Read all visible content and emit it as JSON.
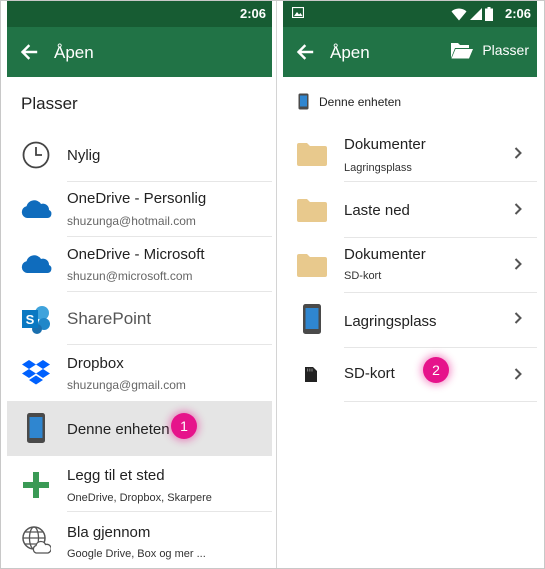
{
  "left": {
    "status": {
      "time": "2:06"
    },
    "appbar": {
      "title": "Åpen"
    },
    "section_title": "Plasser",
    "items": [
      {
        "label": "Nylig",
        "sub": "",
        "icon": "clock-icon"
      },
      {
        "label": "OneDrive - Personlig",
        "sub": "shuzunga@hotmail.com",
        "icon": "onedrive-cloud-icon"
      },
      {
        "label": "OneDrive - Microsoft",
        "sub": "shuzun@microsoft.com",
        "icon": "onedrive-cloud-icon"
      },
      {
        "label": "SharePoint",
        "sub": "",
        "icon": "sharepoint-icon"
      },
      {
        "label": "Dropbox",
        "sub": "shuzunga@gmail.com",
        "icon": "dropbox-icon"
      },
      {
        "label": "Denne enheten",
        "sub": "",
        "icon": "phone-device-icon",
        "selected": true
      },
      {
        "label": "Legg til et sted",
        "sub": "OneDrive, Dropbox, Skarpere",
        "icon": "plus-icon"
      },
      {
        "label": "Bla gjennom",
        "sub": "Google Drive, Box og mer ...",
        "icon": "globe-cloud-icon"
      }
    ],
    "callout": "1"
  },
  "right": {
    "status": {
      "time": "2:06"
    },
    "appbar": {
      "title": "Åpen",
      "action_label": "Plasser"
    },
    "device_header": "Denne enheten",
    "items": [
      {
        "label": "Dokumenter",
        "sub": "Lagringsplass",
        "icon": "folder-icon"
      },
      {
        "label": "Laste ned",
        "sub": "",
        "icon": "folder-icon"
      },
      {
        "label": "Dokumenter",
        "sub": "SD-kort",
        "icon": "folder-icon"
      },
      {
        "label": "Lagringsplass",
        "sub": "",
        "icon": "phone-device-icon"
      },
      {
        "label": "SD-kort",
        "sub": "",
        "icon": "sd-card-icon"
      }
    ],
    "callout": "2"
  },
  "colors": {
    "appbar": "#217346",
    "statusbar": "#175c33",
    "onedrive": "#0f6cbd",
    "sharepoint": "#0a78c2",
    "dropbox": "#0061fe",
    "plus": "#3a9a55",
    "folder": "#e8c98d",
    "callout": "#e6138b",
    "selected_row": "#e5e5e5"
  }
}
